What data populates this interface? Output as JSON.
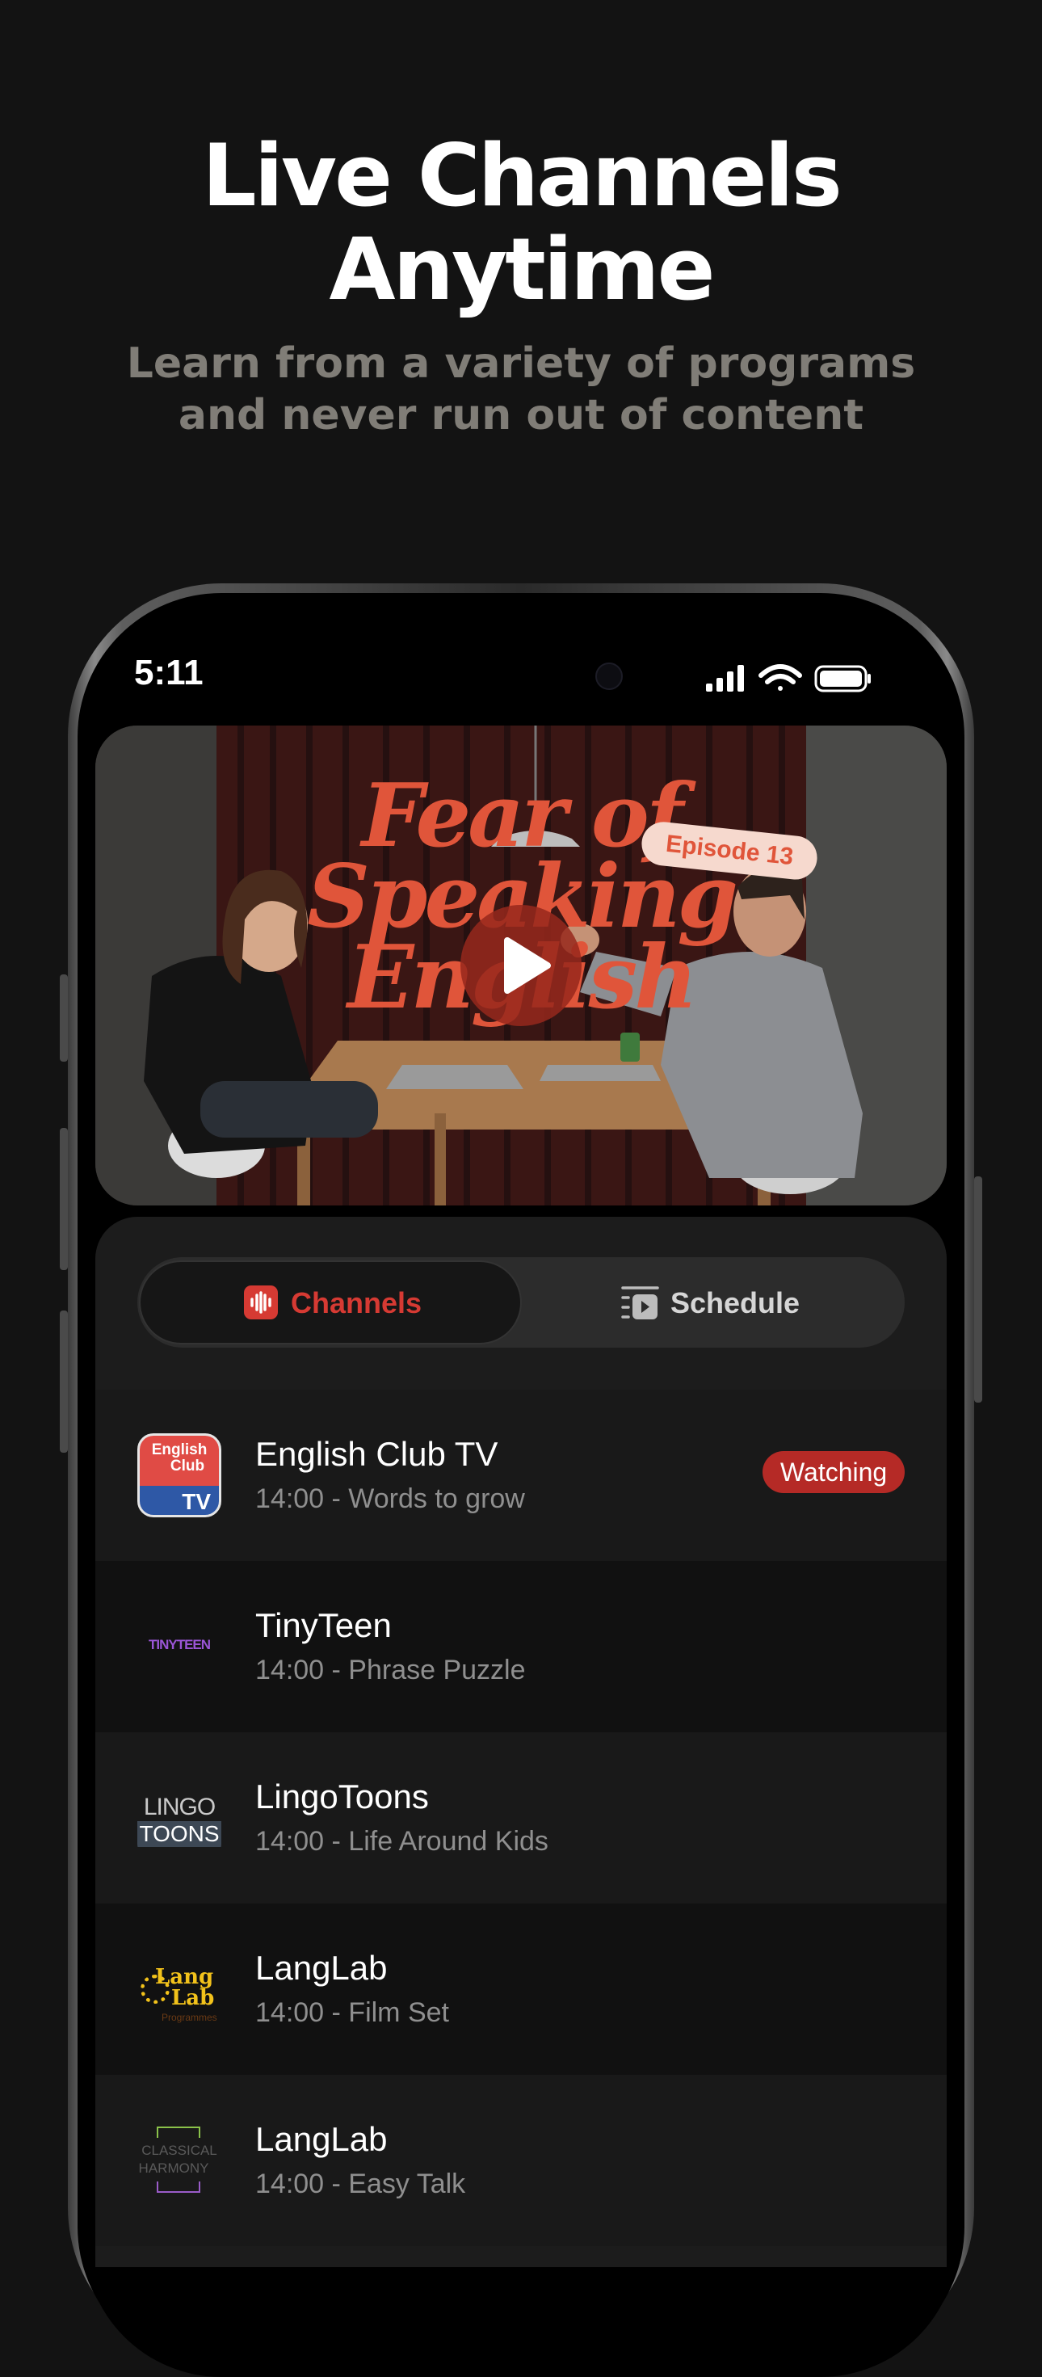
{
  "headline": {
    "line1": "Live Channels",
    "line2": "Anytime"
  },
  "subheadline": {
    "line1": "Learn from a variety of programs",
    "line2": "and never run out of content"
  },
  "status_bar": {
    "time": "5:11"
  },
  "hero": {
    "title_lines": [
      "Fear of",
      "Speaking",
      "English"
    ],
    "episode_tag": "Episode 13"
  },
  "tabs": [
    {
      "label": "Channels",
      "icon": "audio-wave-icon",
      "selected": true
    },
    {
      "label": "Schedule",
      "icon": "schedule-list-icon",
      "selected": false
    }
  ],
  "channels": [
    {
      "name": "English Club TV",
      "program": "14:00 - Words to grow",
      "badge": "Watching",
      "logo_text": [
        "English",
        "Club",
        "TV"
      ]
    },
    {
      "name": "TinyTeen",
      "program": "14:00 - Phrase Puzzle",
      "logo_text": [
        "TINYTEEN"
      ]
    },
    {
      "name": "LingoToons",
      "program": "14:00 - Life Around Kids",
      "logo_text": [
        "LINGO",
        "TOONS"
      ]
    },
    {
      "name": "LangLab",
      "program": "14:00 - Film Set",
      "logo_text": [
        "Lang",
        "Lab",
        "Programmes"
      ]
    },
    {
      "name": "LangLab",
      "program": "14:00 - Easy Talk",
      "logo_text": [
        "CLASSICAL",
        "HARMONY"
      ]
    }
  ],
  "colors": {
    "background": "#131313",
    "accent_red": "#e0553a",
    "badge_red": "#b52a26",
    "subtext_gray": "#807d77"
  }
}
